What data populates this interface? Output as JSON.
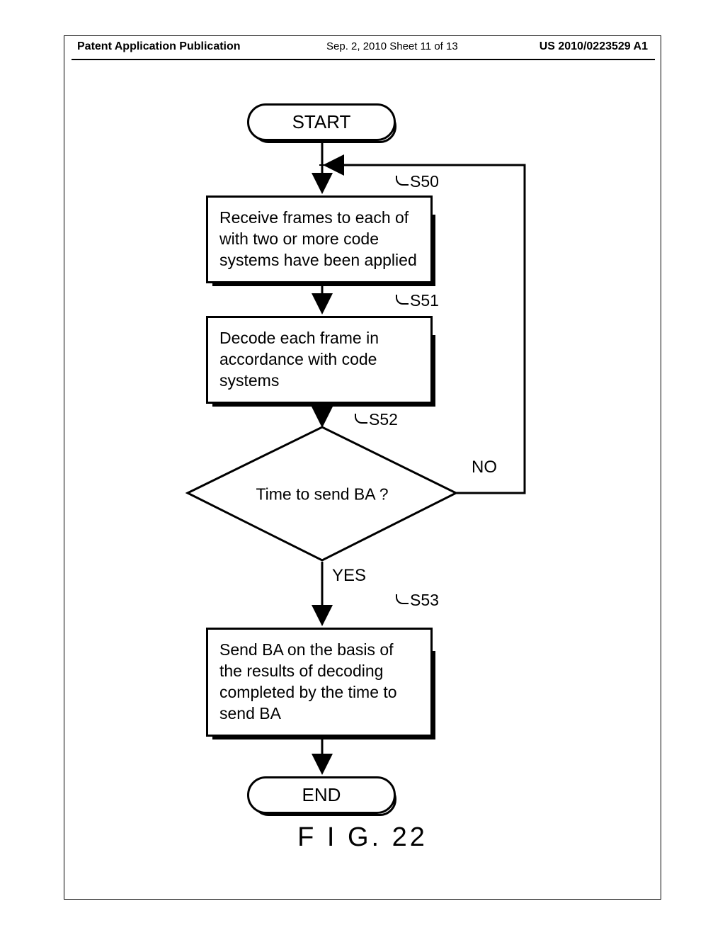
{
  "header": {
    "left": "Patent Application Publication",
    "mid": "Sep. 2, 2010  Sheet 11 of 13",
    "right": "US 2010/0223529 A1"
  },
  "figure_caption": "F I G. 22",
  "flowchart": {
    "start": "START",
    "end": "END",
    "steps": {
      "s50": {
        "tag": "S50",
        "text": "Receive frames to each of with two or more code systems have been applied"
      },
      "s51": {
        "tag": "S51",
        "text": "Decode each frame in accordance with code systems"
      },
      "s52": {
        "tag": "S52",
        "text": "Time to send BA ?",
        "yes": "YES",
        "no": "NO"
      },
      "s53": {
        "tag": "S53",
        "text": "Send BA on the basis of the results of decoding completed by the time to send BA"
      }
    }
  }
}
